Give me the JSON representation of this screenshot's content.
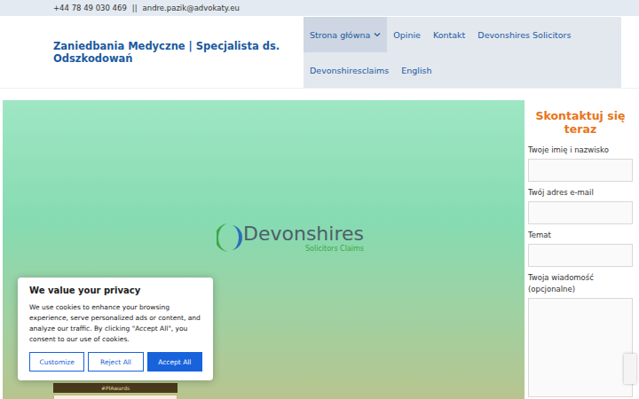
{
  "topbar": {
    "phone": "+44 78 49 030 469",
    "separator": "||",
    "email": "andre.pazik@advokaty.eu"
  },
  "site_title": "Zaniedbania Medyczne | Specjalista ds. Odszkodowań",
  "nav": [
    {
      "label": "Strona główna",
      "selected": true,
      "dropdown": true
    },
    {
      "label": "Opinie",
      "selected": false,
      "dropdown": false
    },
    {
      "label": "Kontakt",
      "selected": false,
      "dropdown": false
    },
    {
      "label": "Devonshires Solicitors",
      "selected": false,
      "dropdown": false
    },
    {
      "label": "Devonshiresclaims",
      "selected": false,
      "dropdown": false
    },
    {
      "label": "English",
      "selected": false,
      "dropdown": false
    }
  ],
  "hero": {
    "logo": "Devonshires",
    "logo_subtitle": "Solicitors Claims",
    "badges": [
      "#PIAwards"
    ]
  },
  "form": {
    "title": "Skontaktuj się teraz",
    "fields": [
      {
        "label": "Twoje imię i nazwisko",
        "kind": "input"
      },
      {
        "label": "Twój adres e-mail",
        "kind": "input"
      },
      {
        "label": "Temat",
        "kind": "input"
      },
      {
        "label": "Twoja wiadomość (opcjonalne)",
        "kind": "textarea"
      }
    ]
  },
  "cookie": {
    "title": "We value your privacy",
    "body": "We use cookies to enhance your browsing experience, serve personalized ads or content, and analyze our traffic. By clicking \"Accept All\", you consent to our use of cookies.",
    "buttons": [
      {
        "label": "Customize",
        "primary": false
      },
      {
        "label": "Reject All",
        "primary": false
      },
      {
        "label": "Accept All",
        "primary": true
      }
    ]
  }
}
